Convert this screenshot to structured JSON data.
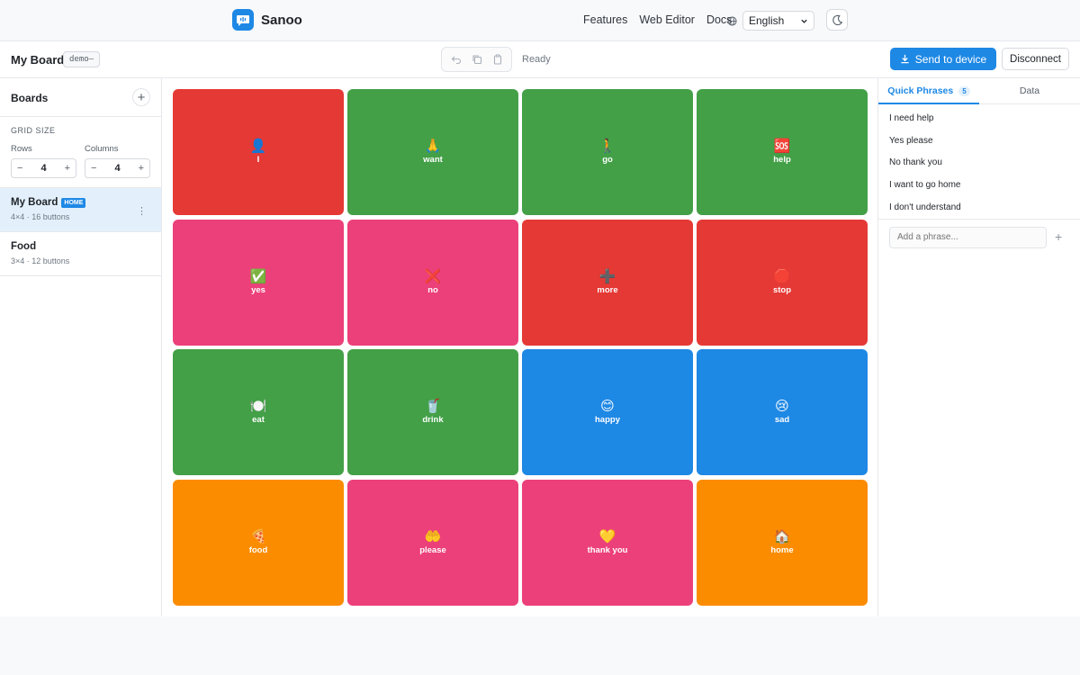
{
  "nav": {
    "brand": "Sanoo",
    "links": [
      "Features",
      "Web Editor",
      "Docs"
    ],
    "language": "English"
  },
  "toolbar": {
    "board_title": "My Board",
    "board_tag": "demo–",
    "status": "Ready",
    "send_label": "Send to device",
    "disconnect_label": "Disconnect"
  },
  "sidebar": {
    "title": "Boards",
    "grid_size_label": "GRID SIZE",
    "rows_label": "Rows",
    "rows_value": "4",
    "columns_label": "Columns",
    "columns_value": "4",
    "boards": [
      {
        "name": "My Board",
        "badge": "HOME",
        "meta": "4×4 · 16 buttons"
      },
      {
        "name": "Food",
        "badge": "",
        "meta": "3×4 · 12 buttons"
      }
    ]
  },
  "grid": {
    "cells": [
      {
        "emoji": "👤",
        "label": "I",
        "color": "#e53935"
      },
      {
        "emoji": "🙏",
        "label": "want",
        "color": "#43a047"
      },
      {
        "emoji": "🚶",
        "label": "go",
        "color": "#43a047"
      },
      {
        "emoji": "🆘",
        "label": "help",
        "color": "#43a047"
      },
      {
        "emoji": "✅",
        "label": "yes",
        "color": "#ec407a"
      },
      {
        "emoji": "❌",
        "label": "no",
        "color": "#ec407a"
      },
      {
        "emoji": "➕",
        "label": "more",
        "color": "#e53935"
      },
      {
        "emoji": "🛑",
        "label": "stop",
        "color": "#e53935"
      },
      {
        "emoji": "🍽️",
        "label": "eat",
        "color": "#43a047"
      },
      {
        "emoji": "🥤",
        "label": "drink",
        "color": "#43a047"
      },
      {
        "emoji": "😊",
        "label": "happy",
        "color": "#1e88e5"
      },
      {
        "emoji": "😢",
        "label": "sad",
        "color": "#1e88e5"
      },
      {
        "emoji": "🍕",
        "label": "food",
        "color": "#fb8c00"
      },
      {
        "emoji": "🤲",
        "label": "please",
        "color": "#ec407a"
      },
      {
        "emoji": "💛",
        "label": "thank you",
        "color": "#ec407a"
      },
      {
        "emoji": "🏠",
        "label": "home",
        "color": "#fb8c00"
      }
    ]
  },
  "panel": {
    "tabs": [
      {
        "label": "Quick Phrases",
        "badge": "5"
      },
      {
        "label": "Data",
        "badge": ""
      }
    ],
    "phrases": [
      "I need help",
      "Yes please",
      "No thank you",
      "I want to go home",
      "I don't understand"
    ],
    "add_placeholder": "Add a phrase..."
  },
  "colors": {
    "accent": "#1e88e5"
  }
}
